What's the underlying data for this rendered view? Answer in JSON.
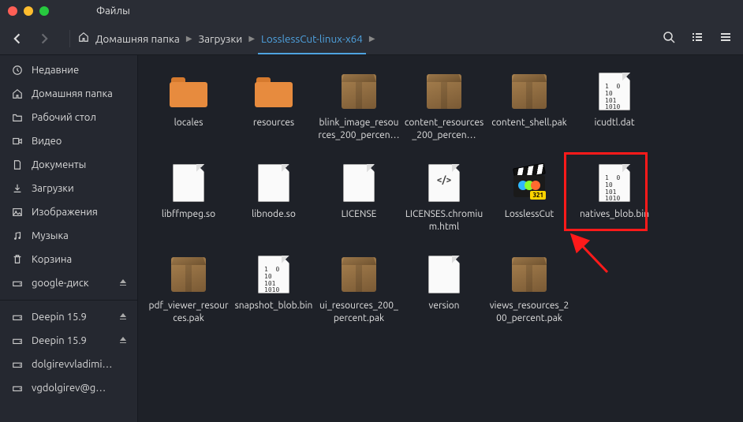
{
  "window": {
    "title": "Файлы"
  },
  "breadcrumbs": {
    "home_label": "Домашняя папка",
    "downloads_label": "Загрузки",
    "current_label": "LosslessCut-linux-x64"
  },
  "sidebar": {
    "items": [
      {
        "label": "Недавние"
      },
      {
        "label": "Домашняя папка"
      },
      {
        "label": "Рабочий стол"
      },
      {
        "label": "Видео"
      },
      {
        "label": "Документы"
      },
      {
        "label": "Загрузки"
      },
      {
        "label": "Изображения"
      },
      {
        "label": "Музыка"
      },
      {
        "label": "Корзина"
      },
      {
        "label": "google-диск"
      }
    ],
    "devices": [
      {
        "label": "Deepin 15.9"
      },
      {
        "label": "Deepin 15.9"
      },
      {
        "label": "dolgirevvladimi…"
      },
      {
        "label": "vgdolgirev@g…"
      }
    ]
  },
  "files": [
    {
      "name": "locales",
      "type": "folder"
    },
    {
      "name": "resources",
      "type": "folder"
    },
    {
      "name": "blink_image_resources_200_percen…",
      "type": "pkg"
    },
    {
      "name": "content_resources_200_percen…",
      "type": "pkg"
    },
    {
      "name": "content_shell.pak",
      "type": "pkg"
    },
    {
      "name": "icudtl.dat",
      "type": "bin"
    },
    {
      "name": "libffmpeg.so",
      "type": "doc"
    },
    {
      "name": "libnode.so",
      "type": "doc"
    },
    {
      "name": "LICENSE",
      "type": "doc"
    },
    {
      "name": "LICENSES.chromium.html",
      "type": "html"
    },
    {
      "name": "LosslessCut",
      "type": "app"
    },
    {
      "name": "natives_blob.bin",
      "type": "bin"
    },
    {
      "name": "pdf_viewer_resources.pak",
      "type": "pkg"
    },
    {
      "name": "snapshot_blob.bin",
      "type": "bin"
    },
    {
      "name": "ui_resources_200_percent.pak",
      "type": "pkg"
    },
    {
      "name": "version",
      "type": "doc"
    },
    {
      "name": "views_resources_200_percent.pak",
      "type": "pkg"
    }
  ],
  "highlight_index": 10
}
